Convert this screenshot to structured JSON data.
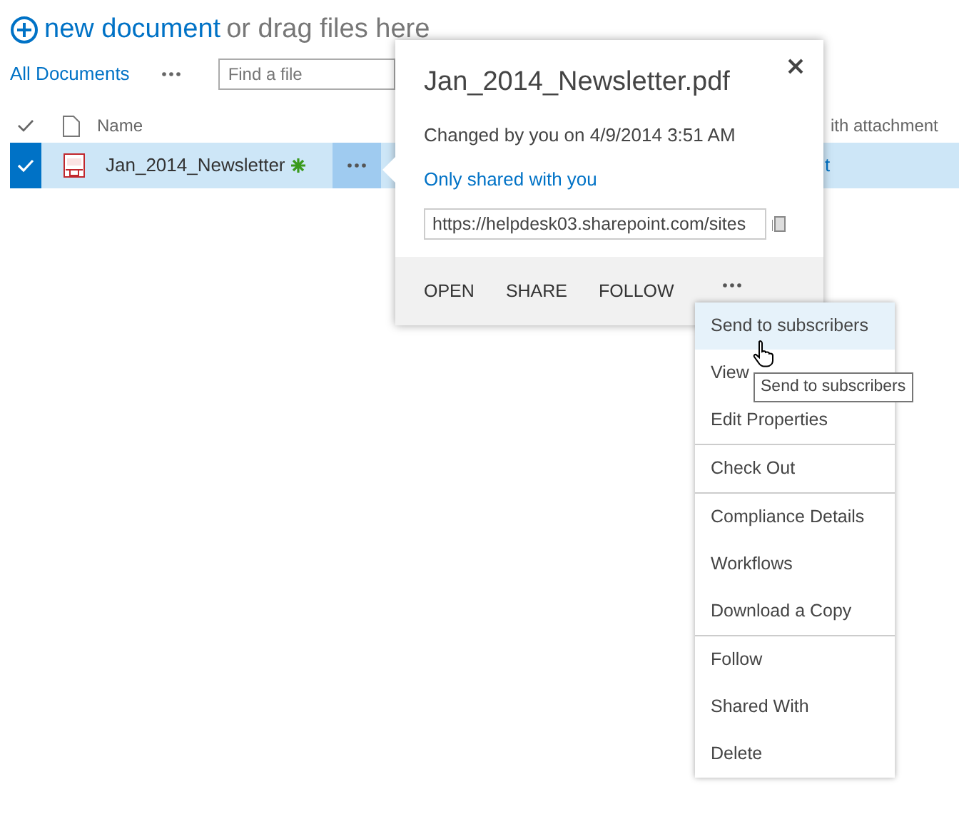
{
  "upload": {
    "link": "new document",
    "hint": "or drag files here"
  },
  "view": {
    "label": "All Documents",
    "search": {
      "placeholder": "Find a file"
    }
  },
  "table": {
    "columns": [
      "Name",
      "ith attachment"
    ],
    "rows": [
      {
        "name": "Jan_2014_Newsletter",
        "is_new": true,
        "selected": true,
        "column_3": "t"
      }
    ]
  },
  "callout": {
    "title": "Jan_2014_Newsletter.pdf",
    "changed": "Changed by you on 4/9/2014 3:51 AM",
    "sharing": "Only shared with you",
    "url": "https://helpdesk03.sharepoint.com/sites",
    "actions": [
      "OPEN",
      "SHARE",
      "FOLLOW"
    ]
  },
  "menu": {
    "groups": [
      [
        {
          "label": "Send to subscribers",
          "hovered": true
        },
        {
          "label": "View",
          "hovered": false
        },
        {
          "label": "Edit Properties",
          "hovered": false
        }
      ],
      [
        {
          "label": "Check Out",
          "hovered": false
        }
      ],
      [
        {
          "label": "Compliance Details",
          "hovered": false
        },
        {
          "label": "Workflows",
          "hovered": false
        },
        {
          "label": "Download a Copy",
          "hovered": false
        }
      ],
      [
        {
          "label": "Follow",
          "hovered": false
        },
        {
          "label": "Shared With",
          "hovered": false
        },
        {
          "label": "Delete",
          "hovered": false
        }
      ]
    ]
  },
  "tooltip": "Send to subscribers"
}
